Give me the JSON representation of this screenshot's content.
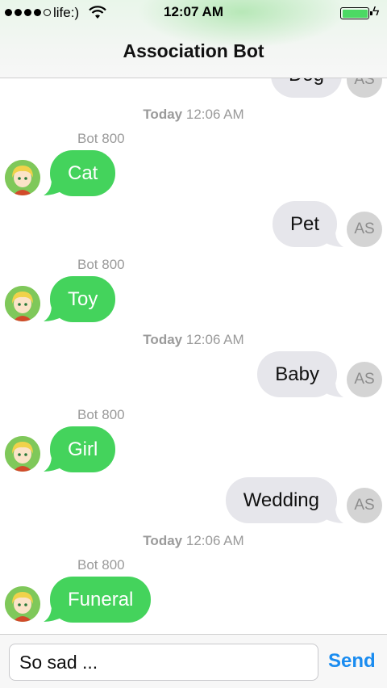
{
  "status_bar": {
    "carrier": "life:)",
    "time": "12:07 AM",
    "signal_bars_filled": 4,
    "signal_bars_total": 5,
    "battery_level": 1.0
  },
  "nav": {
    "title": "Association Bot"
  },
  "conversation": {
    "partial_top_message": "Dog",
    "user_avatar_initials": "AS",
    "bot_name": "Bot 800",
    "timestamps": [
      {
        "day": "Today",
        "time": "12:06 AM"
      },
      {
        "day": "Today",
        "time": "12:06 AM"
      },
      {
        "day": "Today",
        "time": "12:06 AM"
      }
    ],
    "messages": [
      {
        "from": "bot",
        "text": "Cat"
      },
      {
        "from": "user",
        "text": "Pet"
      },
      {
        "from": "bot",
        "text": "Toy"
      },
      {
        "from": "user",
        "text": "Baby"
      },
      {
        "from": "bot",
        "text": "Girl"
      },
      {
        "from": "user",
        "text": "Wedding"
      },
      {
        "from": "bot",
        "text": "Funeral"
      }
    ]
  },
  "composer": {
    "input_value": "So sad ...",
    "send_label": "Send"
  },
  "colors": {
    "bot_bubble": "#44d35c",
    "user_bubble": "#e6e6eb",
    "send_button": "#1a8cf0",
    "battery": "#4cd964"
  }
}
